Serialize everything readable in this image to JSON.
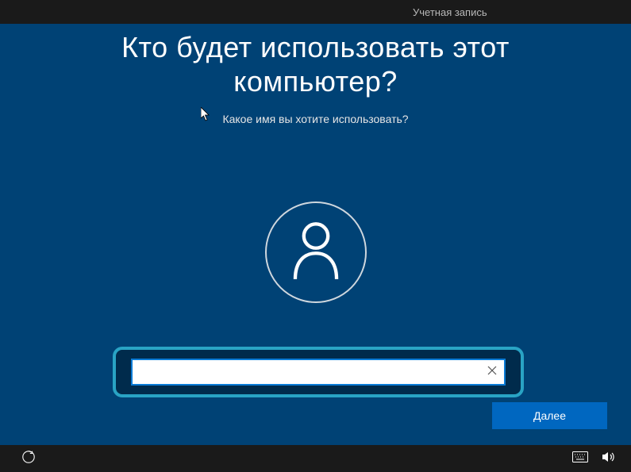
{
  "top": {
    "section_label": "Учетная запись"
  },
  "main": {
    "heading_line1": "Кто будет использовать этот",
    "heading_line2": "компьютер?",
    "subheading": "Какое имя вы хотите использовать?",
    "username_value": "",
    "next_button": "Далее"
  },
  "icons": {
    "avatar": "user-icon",
    "clear": "close-icon",
    "ease": "ease-of-access-icon",
    "keyboard": "keyboard-icon",
    "volume": "volume-icon"
  }
}
